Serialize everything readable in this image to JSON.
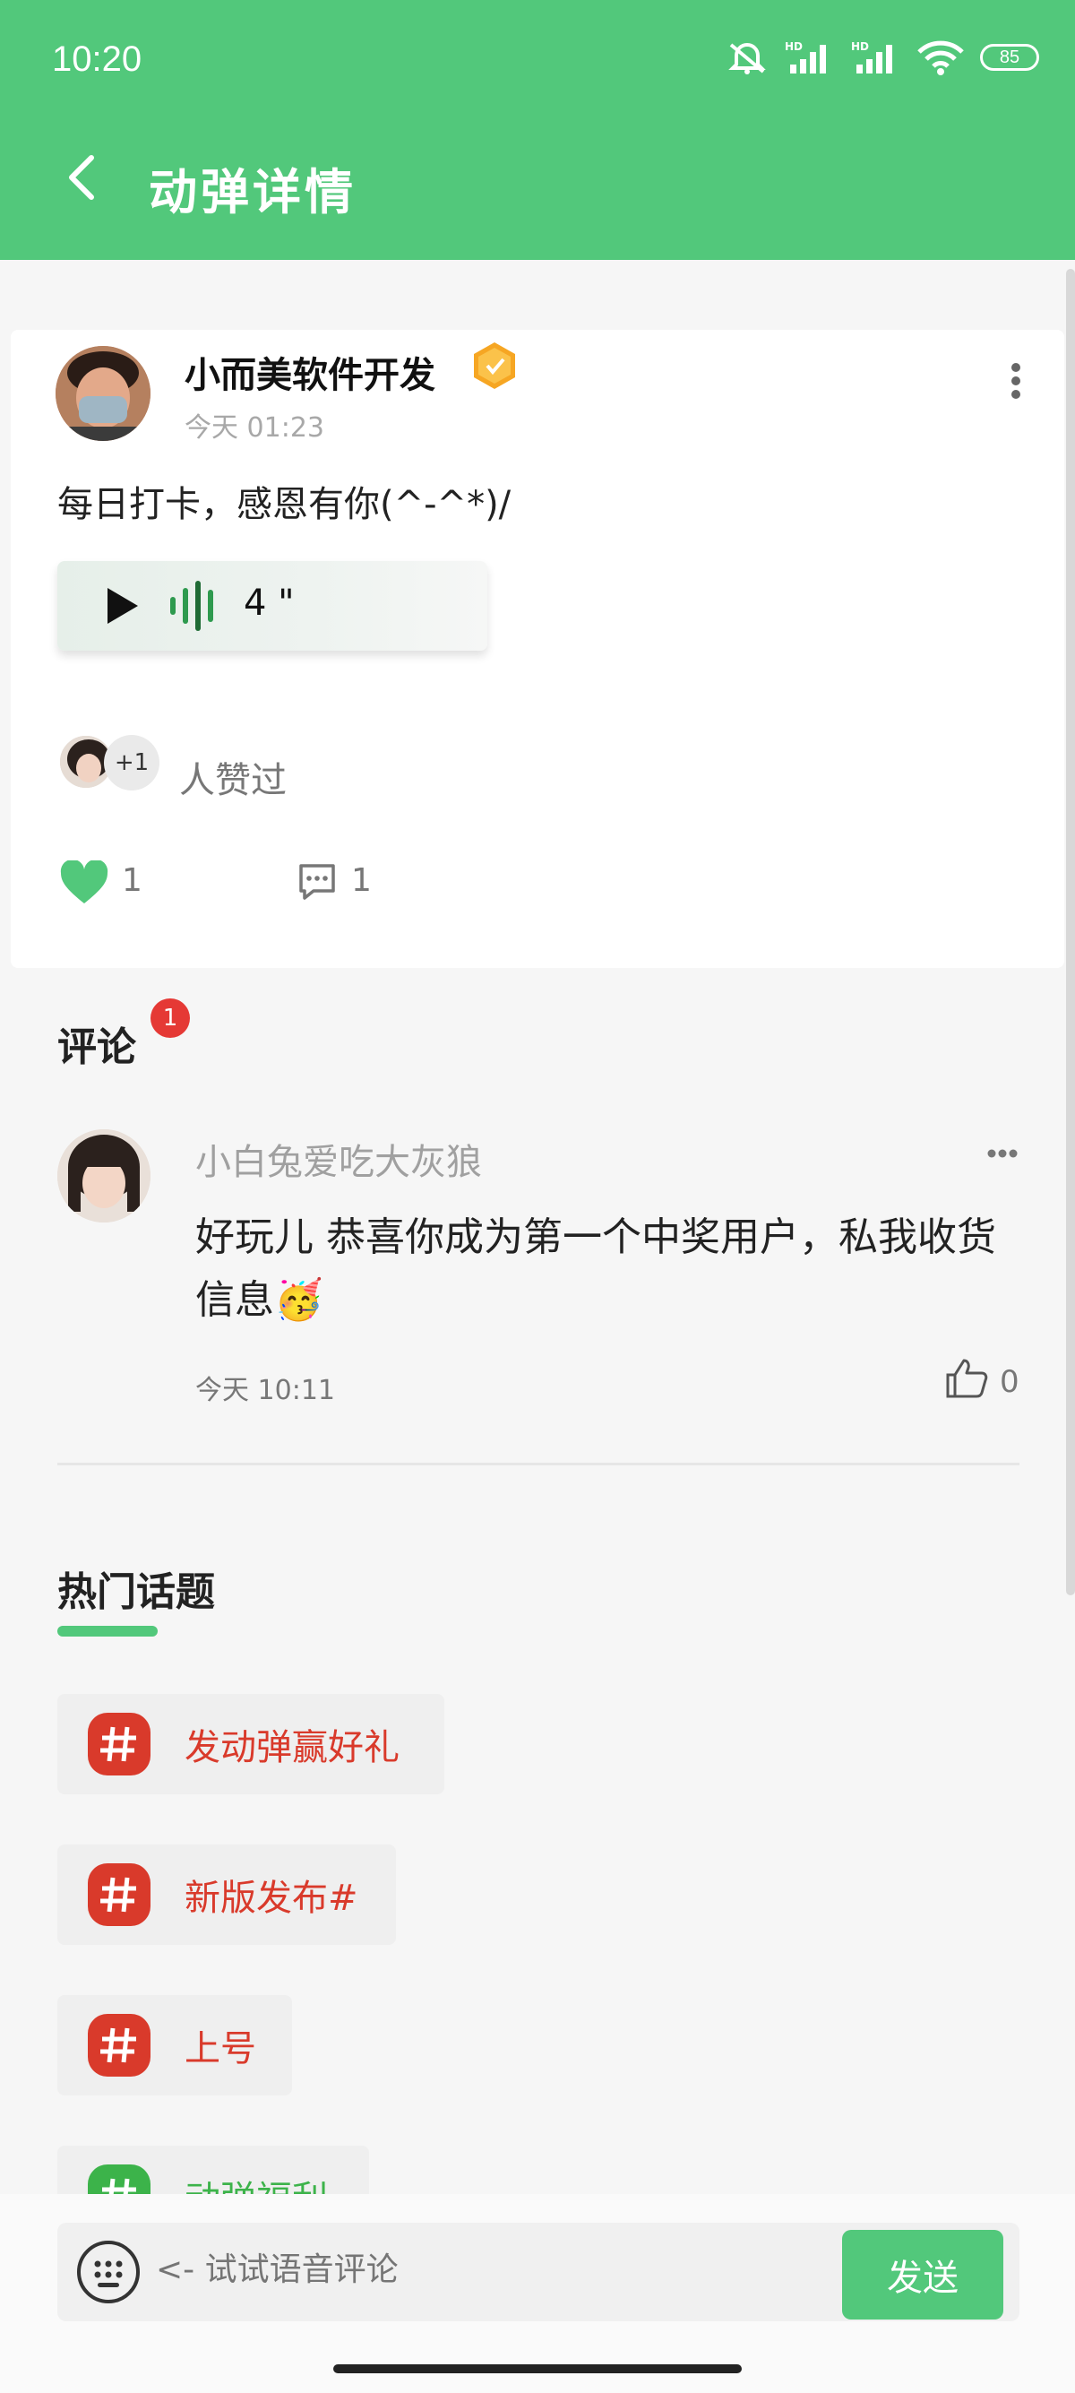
{
  "status_bar": {
    "time": "10:20",
    "battery": "85"
  },
  "header": {
    "title": "动弹详情"
  },
  "post": {
    "author": "小而美软件开发",
    "time": "今天 01:23",
    "text": "每日打卡，感恩有你(^-^*)/",
    "voice_duration": "4 \"",
    "likers_more": "+1",
    "likers_text": "人赞过",
    "like_count": "1",
    "comment_count": "1"
  },
  "comments": {
    "title": "评论",
    "badge": "1",
    "items": [
      {
        "name": "小白兔爱吃大灰狼",
        "text": "好玩儿 恭喜你成为第一个中奖用户，私我收货信息🥳",
        "time": "今天 10:11",
        "likes": "0"
      }
    ]
  },
  "hot_topics": {
    "title": "热门话题",
    "items": [
      {
        "label": "发动弹赢好礼",
        "color": "#d93a2b"
      },
      {
        "label": "新版发布#",
        "color": "#d93a2b"
      },
      {
        "label": "上号",
        "color": "#d93a2b"
      },
      {
        "label": "动弹福利",
        "color": "#3cb34a"
      }
    ]
  },
  "bottom_bar": {
    "placeholder": "<- 试试语音评论",
    "send_label": "发送"
  },
  "colors": {
    "accent": "#52c87b",
    "badge_red": "#e53935",
    "topic_red": "#d93a2b",
    "topic_green": "#3cb34a"
  }
}
